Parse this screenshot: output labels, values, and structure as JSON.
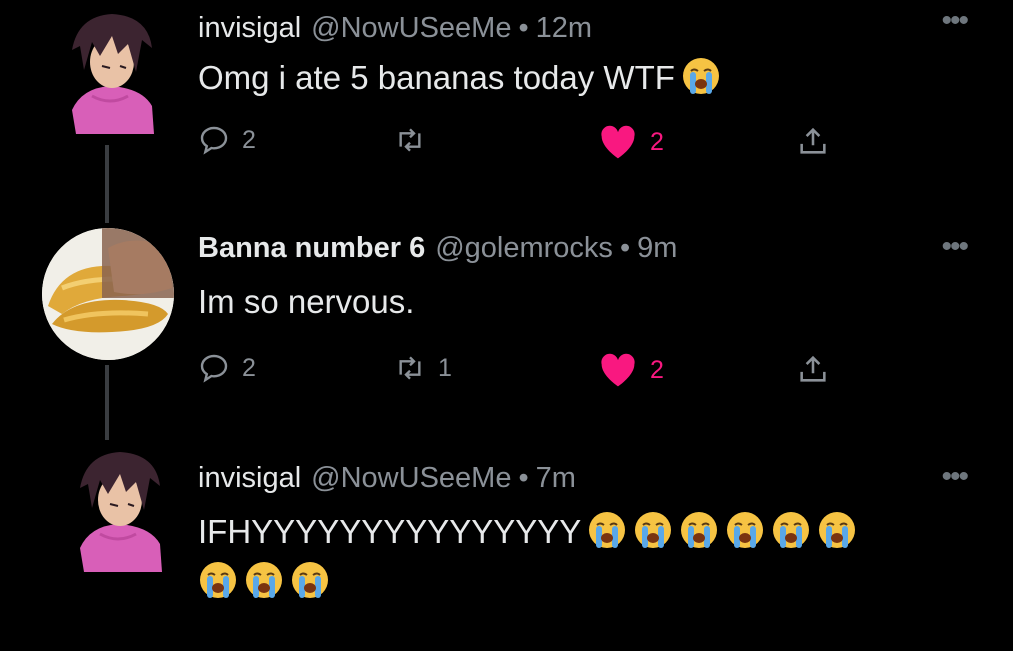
{
  "tweets": [
    {
      "name": "invisigal",
      "handle": "@NowUSeeMe",
      "separator": "•",
      "time": "12m",
      "text": "Omg i ate 5 bananas today WTF",
      "emojis": [
        "loudly-crying-face"
      ],
      "emojis_line2": [],
      "replies": "2",
      "retweets": "",
      "likes": "2",
      "liked": true
    },
    {
      "name": "Banna number 6",
      "handle": "@golemrocks",
      "separator": "•",
      "time": "9m",
      "text": "Im so nervous.",
      "emojis": [],
      "emojis_line2": [],
      "replies": "2",
      "retweets": "1",
      "likes": "2",
      "liked": true
    },
    {
      "name": "invisigal",
      "handle": "@NowUSeeMe",
      "separator": "•",
      "time": "7m",
      "text": "IFHYYYYYYYYYYYYYYY",
      "emojis": [
        "loudly-crying-face",
        "loudly-crying-face",
        "loudly-crying-face",
        "loudly-crying-face",
        "loudly-crying-face",
        "loudly-crying-face"
      ],
      "emojis_line2": [
        "loudly-crying-face",
        "loudly-crying-face",
        "loudly-crying-face"
      ]
    }
  ],
  "more_glyph": "•••",
  "colors": {
    "background": "#000000",
    "like": "#f91880",
    "muted": "#8b9198",
    "text": "#e7e9ea"
  }
}
